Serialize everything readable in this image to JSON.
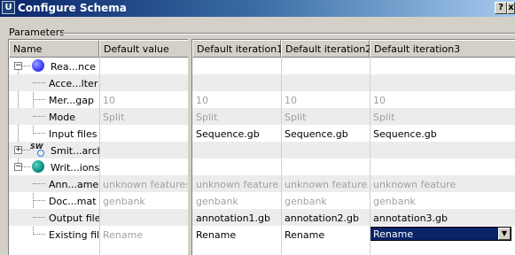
{
  "window": {
    "title": "Configure Schema",
    "icon_letter": "U",
    "help_glyph": "?",
    "close_glyph": "x"
  },
  "group": {
    "label": "Parameters"
  },
  "left_table": {
    "headers": [
      "Name",
      "Default value"
    ],
    "rows": [
      {
        "name": "Rea...nce",
        "default": "",
        "level": 0,
        "expander": "−",
        "icon": "blue-circle-icon"
      },
      {
        "name": "Acce...lter",
        "default": "",
        "level": 1
      },
      {
        "name": "Mer...gap",
        "default": "10",
        "level": 1
      },
      {
        "name": "Mode",
        "default": "Split",
        "level": 1
      },
      {
        "name": "Input files",
        "default": "",
        "level": 1
      },
      {
        "name": "Smit...arch",
        "default": "",
        "level": 0,
        "expander": "+",
        "icon": "sw-search-icon",
        "icon_text": "SW"
      },
      {
        "name": "Writ...ions",
        "default": "",
        "level": 0,
        "expander": "−",
        "icon": "teal-circle-icon"
      },
      {
        "name": "Ann...ame",
        "default": "unknown features",
        "level": 1
      },
      {
        "name": "Doc...mat",
        "default": "genbank",
        "level": 1
      },
      {
        "name": "Output file",
        "default": "",
        "level": 1
      },
      {
        "name": "Existing file",
        "default": "Rename",
        "level": 1
      }
    ]
  },
  "right_table": {
    "headers": [
      "Default iteration1",
      "Default iteration2",
      "Default iteration3"
    ],
    "rows": [
      [
        "",
        "",
        ""
      ],
      [
        "",
        "",
        ""
      ],
      [
        "10",
        "10",
        "10"
      ],
      [
        "Split",
        "Split",
        "Split"
      ],
      [
        "Sequence.gb",
        "Sequence.gb",
        "Sequence.gb"
      ],
      [
        "",
        "",
        ""
      ],
      [
        "",
        "",
        ""
      ],
      [
        "unknown features",
        "unknown features",
        "unknown features"
      ],
      [
        "genbank",
        "genbank",
        "genbank"
      ],
      [
        "annotation1.gb",
        "annotation2.gb",
        "annotation3.gb"
      ],
      [
        "Rename",
        "Rename",
        "Rename"
      ]
    ],
    "muted_rows": [
      2,
      3,
      7,
      8
    ],
    "active_editor": {
      "row": 10,
      "column": 2,
      "value": "Rename",
      "arrow": "▼"
    }
  },
  "colors": {
    "titlebar_start": "#0a246a",
    "titlebar_end": "#a6caf0",
    "selection": "#0a246a",
    "muted_text": "#a0a0a0"
  }
}
